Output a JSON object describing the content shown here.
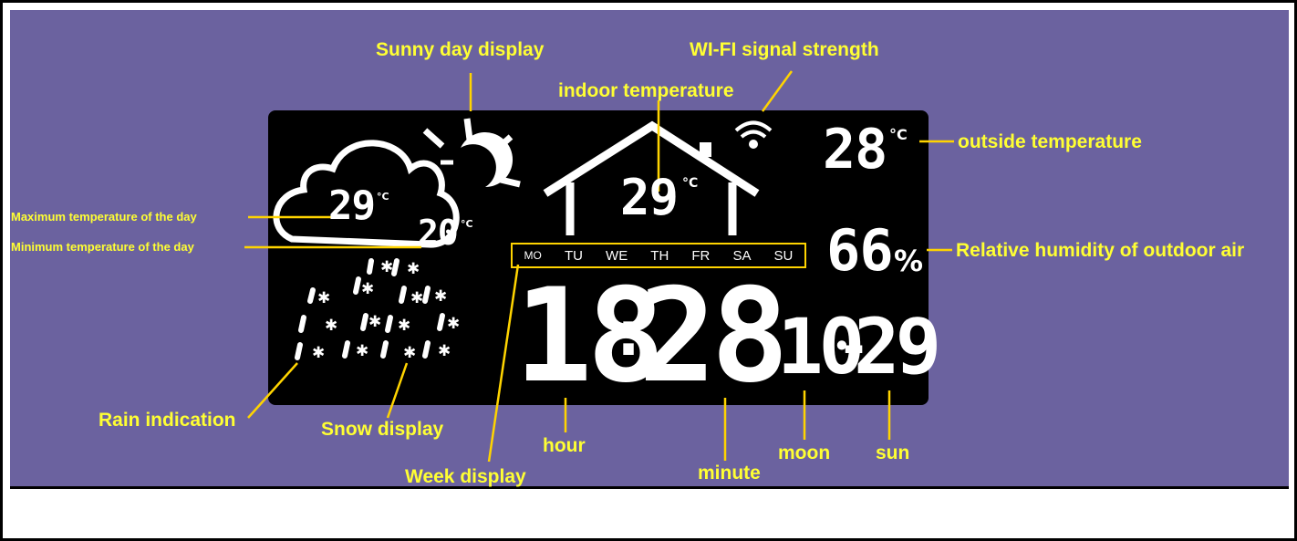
{
  "labels": {
    "sunny": "Sunny day display",
    "wifi": "WI-FI signal strength",
    "indoor": "indoor temperature",
    "outside": "outside temperature",
    "humidity": "Relative humidity of outdoor air",
    "max_temp": "Maximum temperature of the day",
    "min_temp": "Minimum temperature of the day",
    "rain": "Rain indication",
    "snow": "Snow display",
    "week": "Week display",
    "hour": "hour",
    "minute": "minute",
    "moon": "moon",
    "sun": "sun"
  },
  "lcd": {
    "max_temp": "29",
    "min_temp": "20",
    "indoor_temp": "29",
    "outside_temp": "28",
    "humidity": "66",
    "humidity_unit": "%",
    "temp_unit": "°C",
    "hour": "18",
    "colon": ":",
    "minute": "28",
    "month": "10",
    "date_sep": "-",
    "day": "29",
    "weekdays": [
      "MO",
      "TU",
      "WE",
      "TH",
      "FR",
      "SA",
      "SU"
    ]
  },
  "colors": {
    "background": "#6b629f",
    "lcd": "#000000",
    "segment": "#ffffff",
    "label": "#ffff33",
    "leader": "#ffd400"
  },
  "icons": [
    "sun-icon",
    "cloud-icon",
    "house-icon",
    "wifi-icon",
    "rain-icon",
    "snowflake-icon"
  ]
}
